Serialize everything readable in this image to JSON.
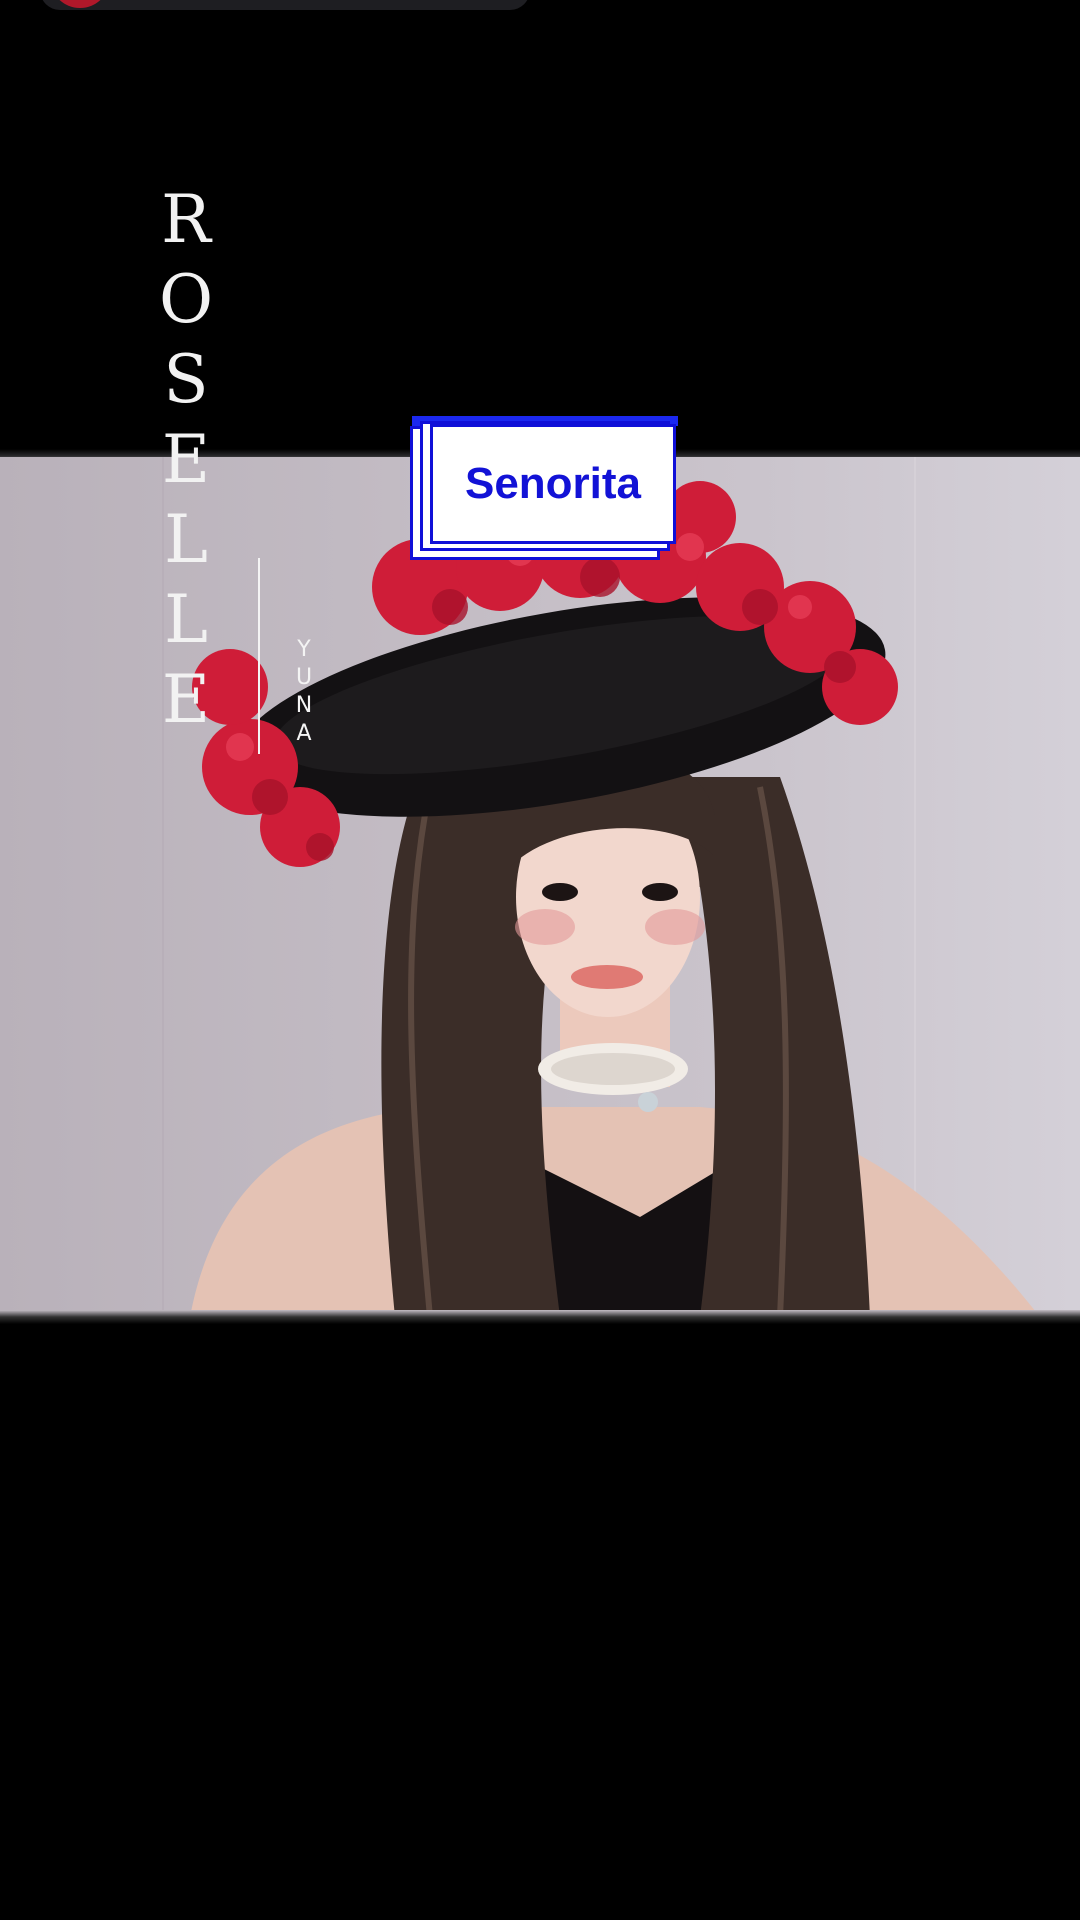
{
  "cover": {
    "title_letters": [
      "R",
      "O",
      "S",
      "E",
      "L",
      "L",
      "E"
    ],
    "subtitle_letters": [
      "Y",
      "U",
      "N",
      "A"
    ]
  },
  "label": {
    "text": "Senorita"
  },
  "colors": {
    "background": "#000000",
    "backdrop": "#c3bcc4",
    "sticker_border": "#1010d8",
    "sticker_text": "#1212d6",
    "flowers": "#d41c3a",
    "hat": "#111111",
    "hair": "#3a2c26"
  },
  "icons": [
    "cover-photo-portrait"
  ]
}
